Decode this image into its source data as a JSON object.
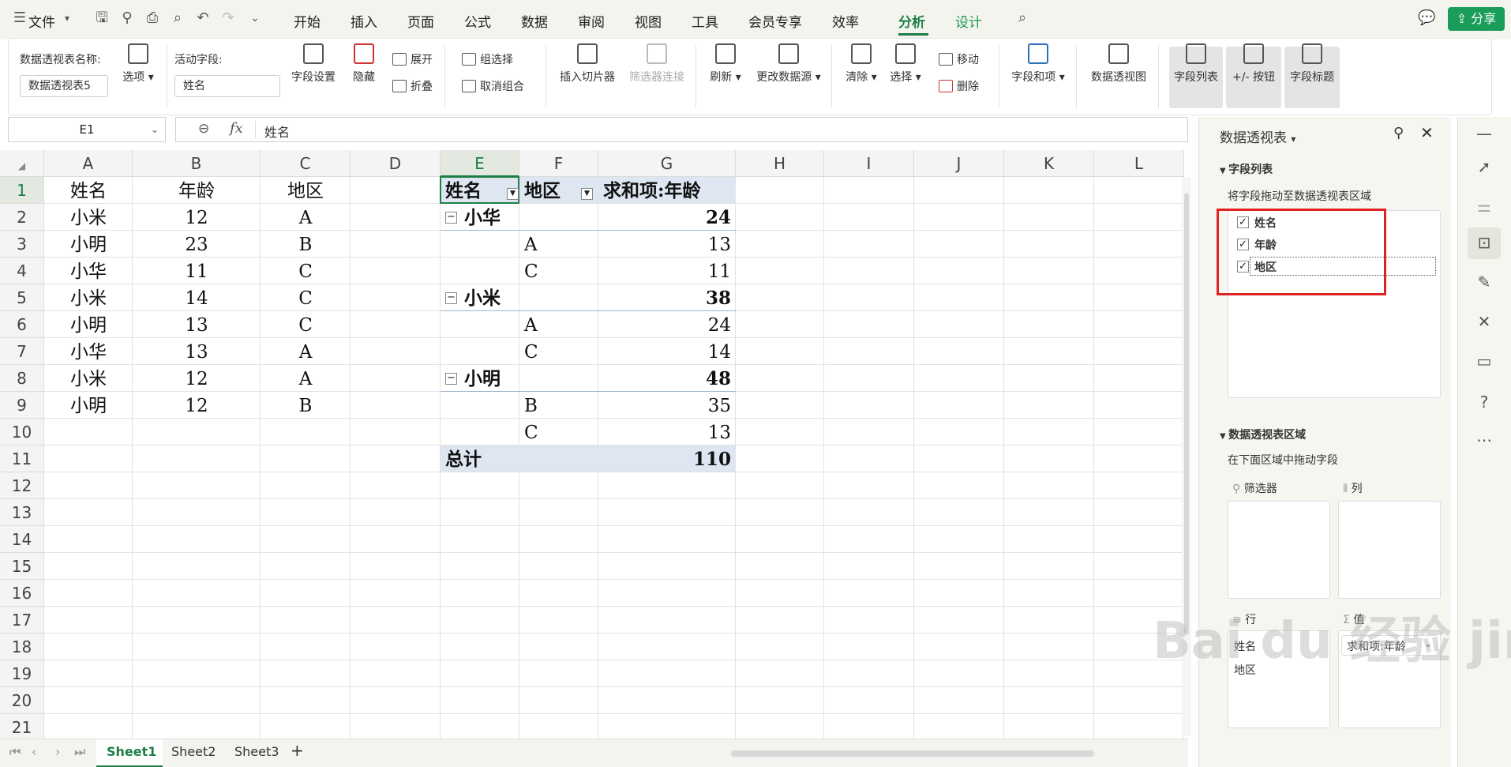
{
  "menubar": {
    "file_label": "文件",
    "tabs": [
      "开始",
      "插入",
      "页面",
      "公式",
      "数据",
      "审阅",
      "视图",
      "工具",
      "会员专享",
      "效率",
      "分析",
      "设计"
    ],
    "share_label": "分享"
  },
  "ribbon": {
    "pivot_name_label": "数据透视表名称:",
    "pivot_name_value": "数据透视表5",
    "options_label": "选项",
    "active_field_label": "活动字段:",
    "active_field_value": "姓名",
    "field_settings": "字段设置",
    "hide": "隐藏",
    "expand": "展开",
    "collapse": "折叠",
    "group_selection": "组选择",
    "ungroup": "取消组合",
    "insert_slicer": "插入切片器",
    "filter_connections": "筛选器连接",
    "refresh": "刷新",
    "change_source": "更改数据源",
    "clear": "清除",
    "select": "选择",
    "move": "移动",
    "delete": "删除",
    "fields_items": "字段和项",
    "pivot_chart": "数据透视图",
    "field_list": "字段列表",
    "plus_minus_buttons": "+/- 按钮",
    "field_headers": "字段标题"
  },
  "formula": {
    "cell_ref": "E1",
    "fx": "fx",
    "content": "姓名"
  },
  "grid": {
    "columns": [
      "A",
      "B",
      "C",
      "D",
      "E",
      "F",
      "G",
      "H",
      "I",
      "J",
      "K",
      "L"
    ],
    "rows": [
      "1",
      "2",
      "3",
      "4",
      "5",
      "6",
      "7",
      "8",
      "9",
      "10",
      "11",
      "12",
      "13",
      "14",
      "15",
      "16",
      "17",
      "18",
      "19",
      "20",
      "21"
    ],
    "source_header": [
      "姓名",
      "年龄",
      "地区"
    ],
    "source_rows": [
      [
        "小米",
        "12",
        "A"
      ],
      [
        "小明",
        "23",
        "B"
      ],
      [
        "小华",
        "11",
        "C"
      ],
      [
        "小米",
        "14",
        "C"
      ],
      [
        "小明",
        "13",
        "C"
      ],
      [
        "小华",
        "13",
        "A"
      ],
      [
        "小米",
        "12",
        "A"
      ],
      [
        "小明",
        "12",
        "B"
      ]
    ],
    "pivot_header": [
      "姓名",
      "地区",
      "求和项:年龄"
    ],
    "pivot_groups": [
      {
        "name": "小华",
        "total": "24",
        "items": [
          [
            "A",
            "13"
          ],
          [
            "C",
            "11"
          ]
        ]
      },
      {
        "name": "小米",
        "total": "38",
        "items": [
          [
            "A",
            "24"
          ],
          [
            "C",
            "14"
          ]
        ]
      },
      {
        "name": "小明",
        "total": "48",
        "items": [
          [
            "B",
            "35"
          ],
          [
            "C",
            "13"
          ]
        ]
      }
    ],
    "grand_total_label": "总计",
    "grand_total_value": "110"
  },
  "sheets": [
    "Sheet1",
    "Sheet2",
    "Sheet3"
  ],
  "panel": {
    "title": "数据透视表",
    "field_list_title": "字段列表",
    "field_list_hint": "将字段拖动至数据透视表区域",
    "fields": [
      "姓名",
      "年龄",
      "地区"
    ],
    "areas_title": "数据透视表区域",
    "areas_hint": "在下面区域中拖动字段",
    "filter_label": "筛选器",
    "column_label": "列",
    "row_label": "行",
    "value_label": "值",
    "row_fields": [
      "姓名",
      "地区"
    ],
    "value_fields": [
      "求和项:年龄"
    ]
  },
  "watermark": "Bai du 经验 jingyan.baidu.com"
}
